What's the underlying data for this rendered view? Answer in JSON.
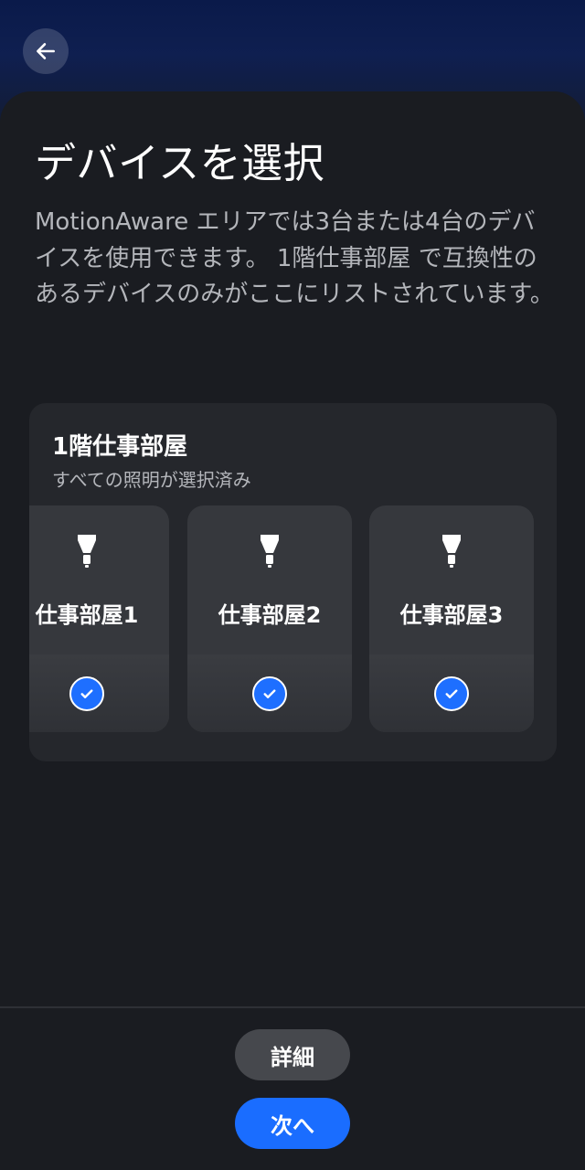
{
  "header": {
    "back_icon": "arrow-left-icon"
  },
  "page": {
    "title": "デバイスを選択",
    "description": "MotionAware エリアでは3台または4台のデバイスを使用できます。 1階仕事部屋 で互換性のあるデバイスのみがここにリストされています。"
  },
  "room": {
    "name": "1階仕事部屋",
    "status": "すべての照明が選択済み",
    "devices": [
      {
        "label": "仕事部屋1",
        "icon": "bulb-icon",
        "selected": true
      },
      {
        "label": "仕事部屋2",
        "icon": "bulb-icon",
        "selected": true
      },
      {
        "label": "仕事部屋3",
        "icon": "bulb-icon",
        "selected": true
      }
    ]
  },
  "footer": {
    "details_label": "詳細",
    "next_label": "次へ"
  },
  "colors": {
    "accent": "#1a6dff",
    "sheet_bg": "#1a1c21",
    "card_bg": "#25272c",
    "device_bg": "#36383d"
  }
}
